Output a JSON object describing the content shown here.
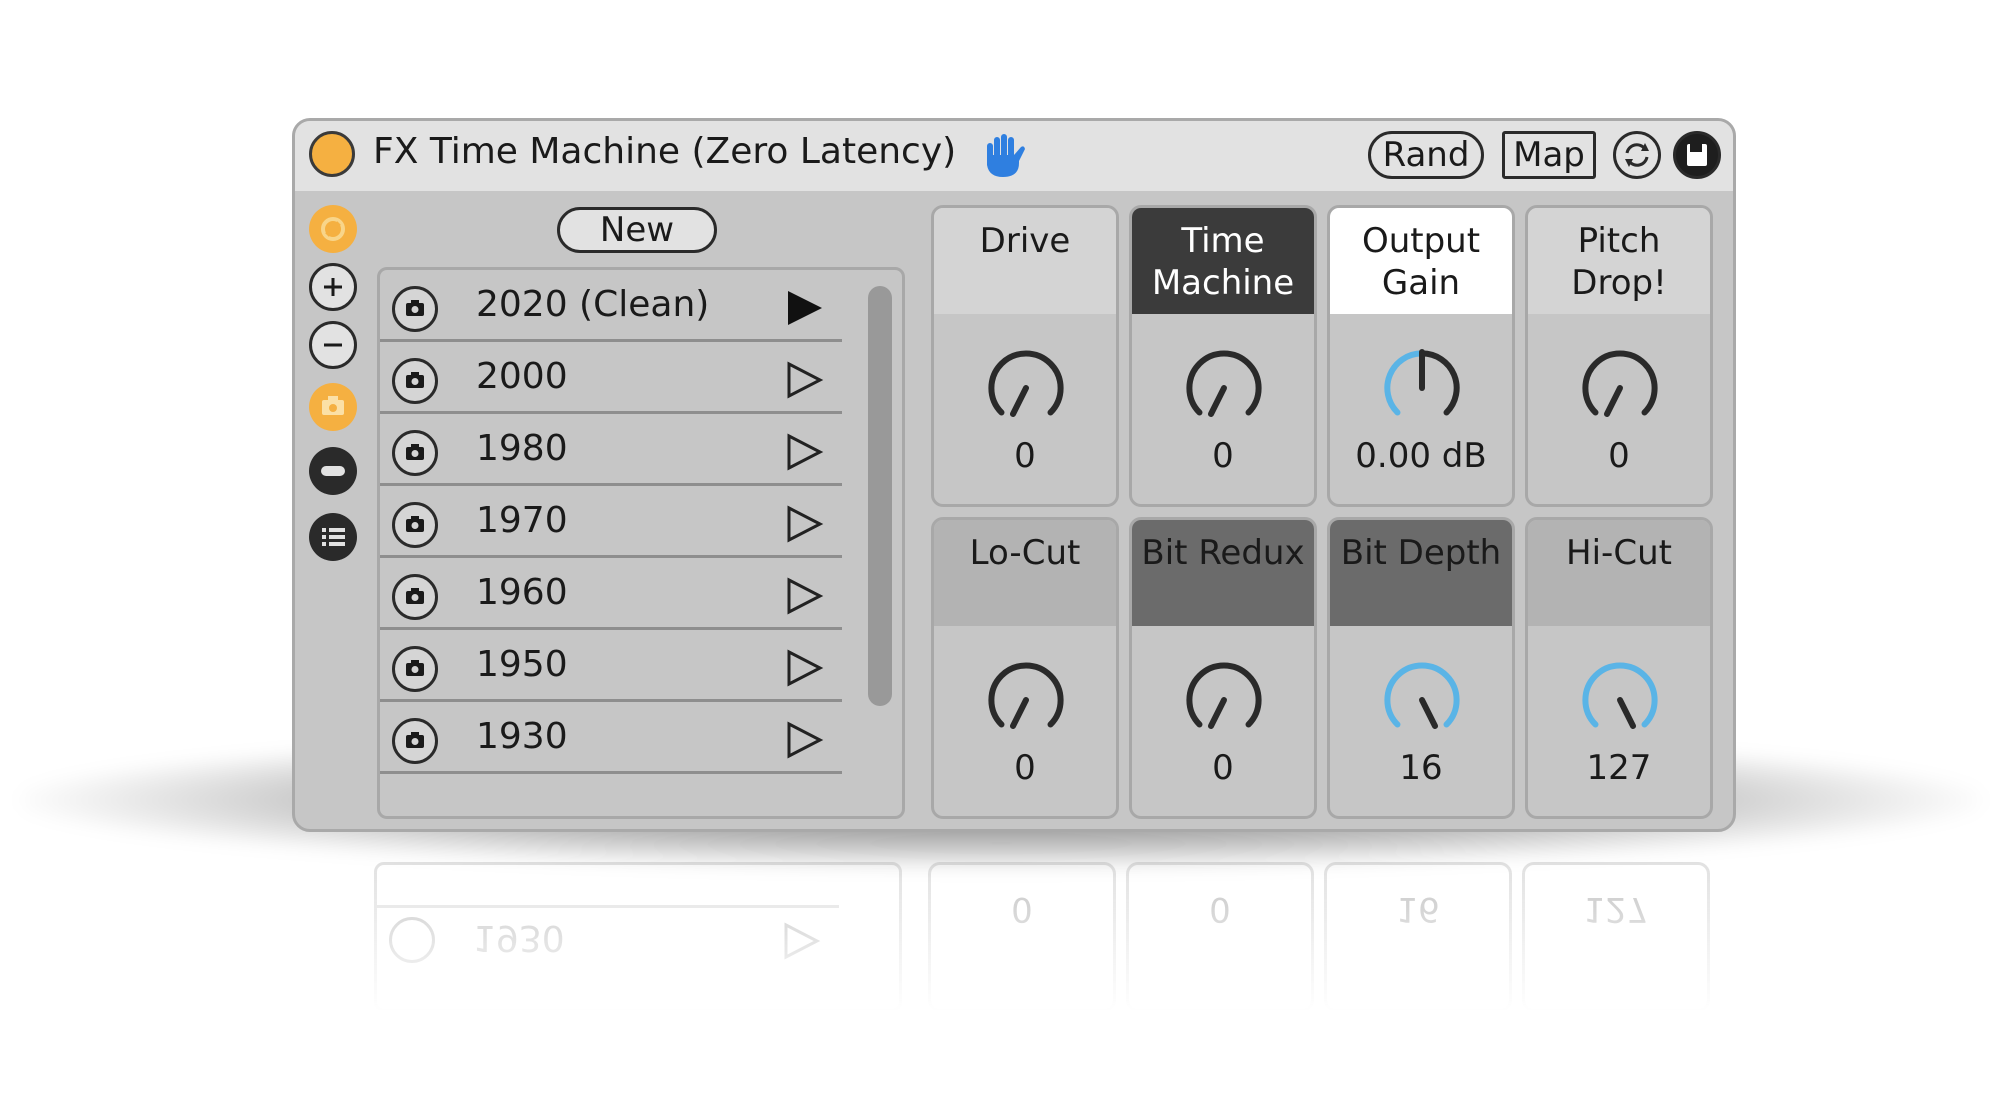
{
  "device": {
    "title": "FX Time Machine (Zero Latency)",
    "rand_label": "Rand",
    "map_label": "Map",
    "accent_color": "#f5b041",
    "knob_active_color": "#5ab4e6"
  },
  "presets": {
    "new_label": "New",
    "items": [
      {
        "label": "2020 (Clean)",
        "playing": true
      },
      {
        "label": "2000",
        "playing": false
      },
      {
        "label": "1980",
        "playing": false
      },
      {
        "label": "1970",
        "playing": false
      },
      {
        "label": "1960",
        "playing": false
      },
      {
        "label": "1950",
        "playing": false
      },
      {
        "label": "1930",
        "playing": false
      }
    ]
  },
  "params": {
    "drive": {
      "label": "Drive",
      "value": "0"
    },
    "time_machine": {
      "label": "Time Machine",
      "value": "0"
    },
    "output_gain": {
      "label": "Output Gain",
      "value": "0.00 dB"
    },
    "pitch_drop": {
      "label": "Pitch Drop!",
      "value": "0"
    },
    "lo_cut": {
      "label": "Lo-Cut",
      "value": "0"
    },
    "bit_redux": {
      "label": "Bit Redux",
      "value": "0"
    },
    "bit_depth": {
      "label": "Bit Depth",
      "value": "16"
    },
    "hi_cut": {
      "label": "Hi-Cut",
      "value": "127"
    }
  },
  "reflection": {
    "row_label": "1930",
    "values": [
      "0",
      "0",
      "16",
      "127"
    ]
  }
}
